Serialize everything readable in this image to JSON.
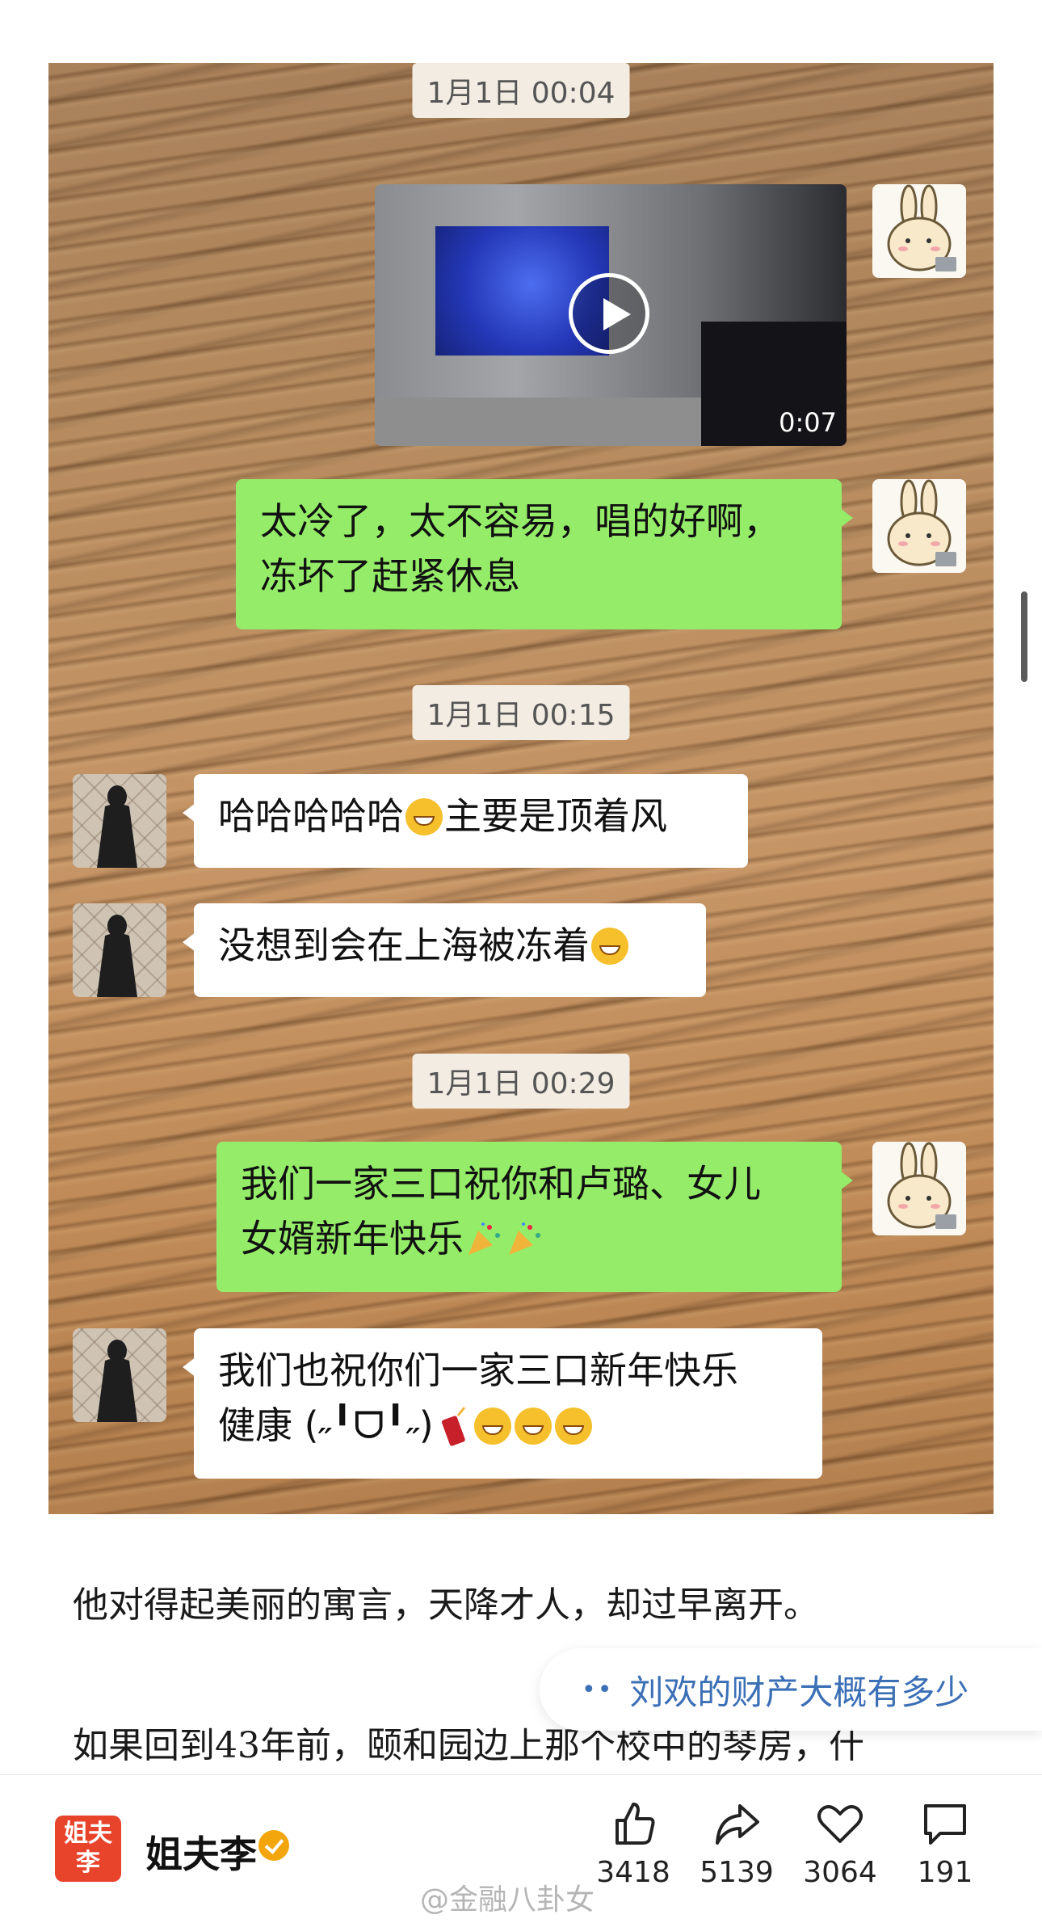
{
  "chat": {
    "timestamps": [
      "1月1日 00:04",
      "1月1日 00:15",
      "1月1日 00:29"
    ],
    "video_duration": "0:07",
    "messages": {
      "m1": {
        "line1": "太冷了，太不容易，唱的好啊，",
        "line2": "冻坏了赶紧休息"
      },
      "m2": {
        "text": "哈哈哈哈哈",
        "text2": "主要是顶着风"
      },
      "m3": {
        "text": "没想到会在上海被冻着"
      },
      "m4": {
        "line1": "我们一家三口祝你和卢璐、女儿",
        "line2": "女婿新年快乐"
      },
      "m5": {
        "line1": "我们也祝你们一家三口新年快乐",
        "line2": "健康 (˶╹ᗜ╹˶)"
      }
    }
  },
  "article": {
    "para1": "他对得起美丽的寓言，天降才人，却过早离开。",
    "para2": "如果回到43年前，颐和园边上那个校中的琴房，什"
  },
  "suggestion": {
    "dots": "••",
    "text": "刘欢的财产大概有多少"
  },
  "bottom": {
    "logo_text": "姐夫李",
    "author": "姐夫李",
    "likes": "3418",
    "shares": "5139",
    "hearts": "3064",
    "comments": "191"
  },
  "watermark": "@金融八卦女",
  "colors": {
    "green_bubble": "#95ec69",
    "link_blue": "#3b6fb6",
    "verified_badge": "#f2a60c",
    "logo_red": "#e8432b"
  }
}
